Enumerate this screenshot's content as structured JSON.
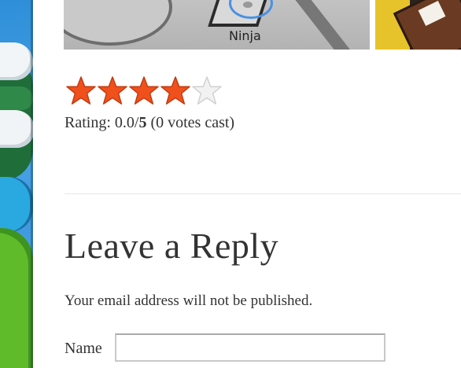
{
  "thumbnail": {
    "ninja_label": "Ninja"
  },
  "rating": {
    "stars_filled": 4,
    "stars_total": 5,
    "prefix": "Rating: ",
    "score": "0.0/",
    "max": "5",
    "votes": " (0 votes cast)"
  },
  "reply": {
    "title": "Leave a Reply",
    "notice": "Your email address will not be published.",
    "name_label": "Name",
    "name_value": ""
  },
  "colors": {
    "star_fill": "#f0501c",
    "star_empty": "#f2f2f2",
    "text": "#333333"
  }
}
